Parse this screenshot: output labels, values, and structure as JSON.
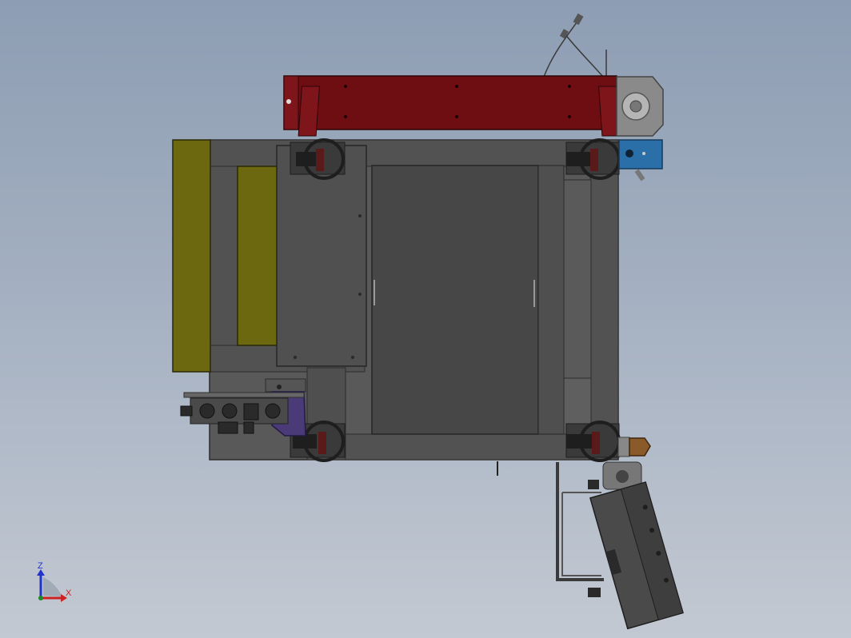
{
  "view": {
    "triad": {
      "z_label": "Z",
      "x_label": "X",
      "z_color": "#2233cc",
      "x_color": "#cc2222"
    },
    "colors": {
      "frame": "#545454",
      "frame_dark": "#3c3c3c",
      "panel": "#4e4e4e",
      "red_beam": "#6e0e12",
      "olive": "#6d6a10",
      "blue_block": "#2a6ea8",
      "purple_bracket": "#4a3a78",
      "brown_part": "#8a5a2a",
      "caster": "#2a2a2a"
    }
  }
}
